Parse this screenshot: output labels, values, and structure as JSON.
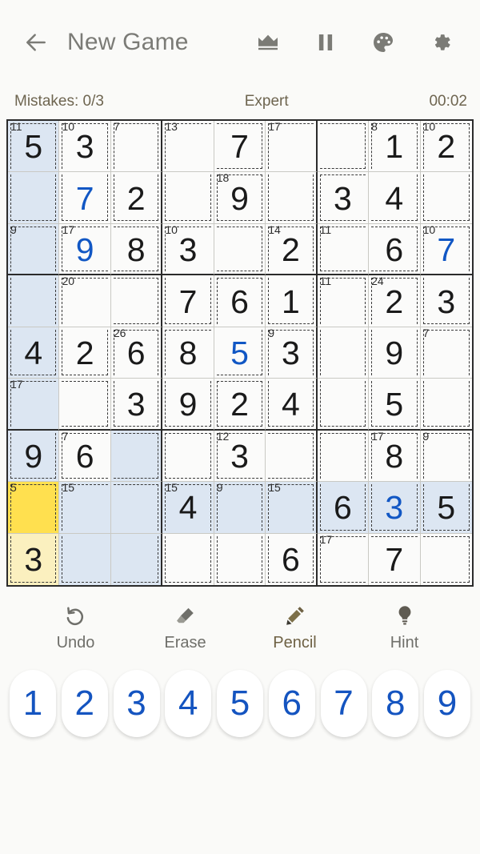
{
  "appbar": {
    "back_icon": "arrow-left-icon",
    "title": "New Game",
    "icons": [
      {
        "name": "crown-icon",
        "label": "Crown"
      },
      {
        "name": "pause-icon",
        "label": "Pause"
      },
      {
        "name": "palette-icon",
        "label": "Theme"
      },
      {
        "name": "gear-icon",
        "label": "Settings"
      }
    ]
  },
  "status": {
    "mistakes": "Mistakes: 0/3",
    "difficulty": "Expert",
    "timer": "00:02"
  },
  "board": {
    "rows": 9,
    "cols": 9,
    "colors": {
      "given": "#1a1a1a",
      "user": "#1157c4",
      "selected_cell": "#ffe04f",
      "selected_cage": "#fbf0bf",
      "peer_highlight": "#dce6f2",
      "grid_line": "#c9c9c4",
      "box_line": "#2b2b2b",
      "cage_line": "#3a3a3a"
    },
    "selected": {
      "row": 8,
      "col": 1
    },
    "values": [
      [
        "5",
        "3",
        "",
        "",
        "7",
        "",
        "",
        "1",
        "2"
      ],
      [
        "",
        "7",
        "2",
        "",
        "9",
        "",
        "3",
        "4",
        ""
      ],
      [
        "",
        "9",
        "8",
        "3",
        "",
        "2",
        "",
        "6",
        "7"
      ],
      [
        "",
        "",
        "",
        "7",
        "6",
        "1",
        "",
        "2",
        "3"
      ],
      [
        "4",
        "2",
        "6",
        "8",
        "5",
        "3",
        "",
        "9",
        ""
      ],
      [
        "",
        "",
        "3",
        "9",
        "2",
        "4",
        "",
        "5",
        ""
      ],
      [
        "9",
        "6",
        "",
        "",
        "3",
        "",
        "",
        "8",
        ""
      ],
      [
        "",
        "",
        "",
        "4",
        "",
        "",
        "6",
        "3",
        "5"
      ],
      [
        "3",
        "",
        "",
        "",
        "",
        "6",
        "",
        "7",
        ""
      ]
    ],
    "user_entered": [
      [
        false,
        false,
        false,
        false,
        false,
        false,
        false,
        false,
        false
      ],
      [
        false,
        true,
        false,
        false,
        false,
        false,
        false,
        false,
        false
      ],
      [
        false,
        true,
        false,
        false,
        false,
        false,
        false,
        false,
        true
      ],
      [
        false,
        false,
        false,
        false,
        false,
        false,
        false,
        false,
        false
      ],
      [
        false,
        false,
        false,
        false,
        true,
        false,
        false,
        false,
        false
      ],
      [
        false,
        false,
        false,
        false,
        false,
        false,
        false,
        false,
        false
      ],
      [
        false,
        false,
        false,
        false,
        false,
        false,
        false,
        false,
        false
      ],
      [
        false,
        false,
        false,
        false,
        false,
        false,
        false,
        true,
        false
      ],
      [
        false,
        false,
        false,
        false,
        false,
        false,
        false,
        false,
        false
      ]
    ],
    "cage_sums": [
      [
        "11",
        "10",
        "7",
        "13",
        "",
        "17",
        "",
        "8",
        "10"
      ],
      [
        "",
        "",
        "",
        "",
        "18",
        "",
        "",
        "",
        ""
      ],
      [
        "9",
        "17",
        "",
        "10",
        "",
        "14",
        "11",
        "",
        "10"
      ],
      [
        "",
        "20",
        "",
        "",
        "",
        "",
        "11",
        "24",
        ""
      ],
      [
        "",
        "",
        "26",
        "",
        "",
        "9",
        "",
        "",
        "7"
      ],
      [
        "17",
        "",
        "",
        "",
        "",
        "",
        "",
        "",
        ""
      ],
      [
        "",
        "7",
        "",
        "",
        "12",
        "",
        "",
        "17",
        "9"
      ],
      [
        "5",
        "15",
        "",
        "15",
        "9",
        "15",
        "",
        "",
        ""
      ],
      [
        "",
        "",
        "",
        "",
        "",
        "",
        "17",
        "",
        ""
      ]
    ],
    "cage_ids": [
      [
        1,
        2,
        3,
        4,
        4,
        5,
        5,
        6,
        7
      ],
      [
        1,
        2,
        3,
        4,
        8,
        5,
        6,
        6,
        7
      ],
      [
        9,
        10,
        10,
        11,
        11,
        12,
        13,
        13,
        14
      ],
      [
        9,
        15,
        15,
        11,
        16,
        12,
        17,
        18,
        14
      ],
      [
        9,
        15,
        19,
        16,
        16,
        20,
        17,
        18,
        21
      ],
      [
        22,
        22,
        19,
        16,
        23,
        20,
        17,
        18,
        21
      ],
      [
        22,
        24,
        24,
        25,
        26,
        26,
        27,
        28,
        29
      ],
      [
        30,
        31,
        31,
        32,
        33,
        34,
        27,
        28,
        29
      ],
      [
        30,
        31,
        31,
        32,
        33,
        34,
        35,
        35,
        35
      ]
    ],
    "peer_highlight_cells": [
      [
        0,
        0
      ],
      [
        1,
        0
      ],
      [
        2,
        0
      ],
      [
        3,
        0
      ],
      [
        4,
        0
      ],
      [
        5,
        0
      ],
      [
        6,
        0
      ],
      [
        8,
        0
      ],
      [
        6,
        2
      ],
      [
        7,
        1
      ],
      [
        7,
        2
      ],
      [
        7,
        3
      ],
      [
        7,
        4
      ],
      [
        7,
        5
      ],
      [
        7,
        6
      ],
      [
        7,
        7
      ],
      [
        7,
        8
      ],
      [
        8,
        1
      ],
      [
        8,
        2
      ]
    ],
    "cage_highlight_cells": [
      [
        8,
        0
      ]
    ]
  },
  "actions": [
    {
      "icon": "undo-icon",
      "label": "Undo"
    },
    {
      "icon": "eraser-icon",
      "label": "Erase"
    },
    {
      "icon": "pencil-icon",
      "label": "Pencil"
    },
    {
      "icon": "bulb-icon",
      "label": "Hint"
    }
  ],
  "numpad": {
    "keys": [
      "1",
      "2",
      "3",
      "4",
      "5",
      "6",
      "7",
      "8",
      "9"
    ],
    "color": "#1454c0"
  }
}
